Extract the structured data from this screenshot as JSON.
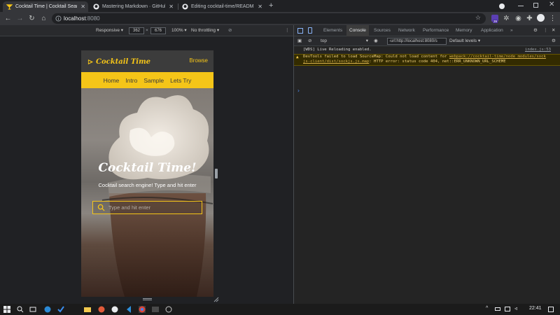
{
  "browser": {
    "tabs": [
      {
        "title": "Cocktail Time | Cocktail Search E",
        "active": true,
        "icon": "cocktail-favicon"
      },
      {
        "title": "Mastering Markdown · GitHub G",
        "active": false,
        "icon": "github-icon"
      },
      {
        "title": "Editing cocktail-time/README.m",
        "active": false,
        "icon": "github-icon"
      }
    ],
    "new_tab": "+",
    "address": {
      "host": "localhost",
      "port": ":8080"
    }
  },
  "device_toolbar": {
    "mode": "Responsive",
    "width": "362",
    "times": "×",
    "height": "676",
    "zoom": "100%",
    "throttle": "No throttling"
  },
  "app": {
    "brand": "Cocktail Time",
    "browse": "Browse",
    "nav": [
      "Home",
      "Intro",
      "Sample",
      "Lets Try"
    ],
    "hero_title": "Cocktail Time!",
    "hero_subtitle": "Cocktail search engine! Type and hit enter",
    "search_placeholder": "Type and hit enter",
    "colors": {
      "accent": "#f5c518",
      "header": "#3c3c3c"
    }
  },
  "devtools": {
    "tabs": [
      "Elements",
      "Console",
      "Sources",
      "Network",
      "Performance",
      "Memory",
      "Application"
    ],
    "active_tab": "Console",
    "more_tabs": "»",
    "context": "top",
    "filter_value": "-url:http://localhost:8080/s",
    "levels": "Default levels",
    "messages": [
      {
        "type": "log",
        "text": "[WDS] Live Reloading enabled.",
        "source": "index.js:53"
      },
      {
        "type": "warning",
        "text": "DevTools failed to load SourceMap: Could not load content for ",
        "link": "webpack://cocktail-time/node_modules/sock js-client/dist/sockjs.js.map",
        "tail": ": HTTP error: status code 404, net::ERR_UNKNOWN_URL_SCHEME"
      }
    ],
    "prompt": "›",
    "badge": "39"
  },
  "taskbar": {
    "time": "22:41"
  }
}
